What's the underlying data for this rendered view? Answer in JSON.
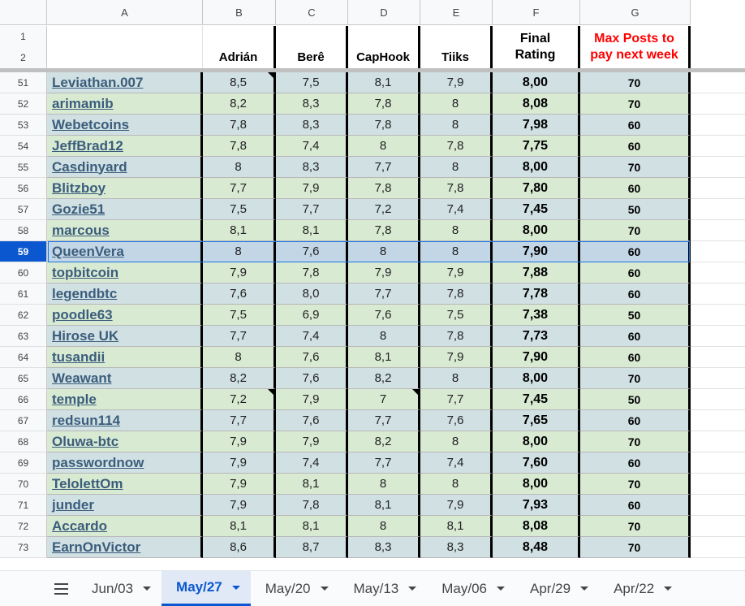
{
  "columns": [
    "A",
    "B",
    "C",
    "D",
    "E",
    "F",
    "G"
  ],
  "header": {
    "row_numbers": [
      "1",
      "2"
    ],
    "reviewers": [
      "Adrián",
      "Berê",
      "CapHook",
      "Tiiks"
    ],
    "final_rating": [
      "Final",
      "Rating"
    ],
    "max_posts": [
      "Max Posts to",
      "pay next week"
    ]
  },
  "rows": [
    {
      "n": "51",
      "user": "Leviathan.007",
      "b": "8,5",
      "c": "7,5",
      "d": "8,1",
      "e": "7,9",
      "final": "8,00",
      "max": "70"
    },
    {
      "n": "52",
      "user": "arimamib",
      "b": "8,2",
      "c": "8,3",
      "d": "7,8",
      "e": "8",
      "final": "8,08",
      "max": "70"
    },
    {
      "n": "53",
      "user": "Webetcoins",
      "b": "7,8",
      "c": "8,3",
      "d": "7,8",
      "e": "8",
      "final": "7,98",
      "max": "60"
    },
    {
      "n": "54",
      "user": "JeffBrad12",
      "b": "7,8",
      "c": "7,4",
      "d": "8",
      "e": "7,8",
      "final": "7,75",
      "max": "60"
    },
    {
      "n": "55",
      "user": "Casdinyard",
      "b": "8",
      "c": "8,3",
      "d": "7,7",
      "e": "8",
      "final": "8,00",
      "max": "70"
    },
    {
      "n": "56",
      "user": "Blitzboy",
      "b": "7,7",
      "c": "7,9",
      "d": "7,8",
      "e": "7,8",
      "final": "7,80",
      "max": "60"
    },
    {
      "n": "57",
      "user": "Gozie51",
      "b": "7,5",
      "c": "7,7",
      "d": "7,2",
      "e": "7,4",
      "final": "7,45",
      "max": "50"
    },
    {
      "n": "58",
      "user": "marcous",
      "b": "8,1",
      "c": "8,1",
      "d": "7,8",
      "e": "8",
      "final": "8,00",
      "max": "70"
    },
    {
      "n": "59",
      "user": "QueenVera",
      "b": "8",
      "c": "7,6",
      "d": "8",
      "e": "8",
      "final": "7,90",
      "max": "60"
    },
    {
      "n": "60",
      "user": "topbitcoin",
      "b": "7,9",
      "c": "7,8",
      "d": "7,9",
      "e": "7,9",
      "final": "7,88",
      "max": "60"
    },
    {
      "n": "61",
      "user": "legendbtc",
      "b": "7,6",
      "c": "8,0",
      "d": "7,7",
      "e": "7,8",
      "final": "7,78",
      "max": "60"
    },
    {
      "n": "62",
      "user": "poodle63",
      "b": "7,5",
      "c": "6,9",
      "d": "7,6",
      "e": "7,5",
      "final": "7,38",
      "max": "50"
    },
    {
      "n": "63",
      "user": "Hirose UK",
      "b": "7,7",
      "c": "7,4",
      "d": "8",
      "e": "7,8",
      "final": "7,73",
      "max": "60"
    },
    {
      "n": "64",
      "user": "tusandii",
      "b": "8",
      "c": "7,6",
      "d": "8,1",
      "e": "7,9",
      "final": "7,90",
      "max": "60"
    },
    {
      "n": "65",
      "user": "Weawant",
      "b": "8,2",
      "c": "7,6",
      "d": "8,2",
      "e": "8",
      "final": "8,00",
      "max": "70"
    },
    {
      "n": "66",
      "user": "temple",
      "b": "7,2",
      "c": "7,9",
      "d": "7",
      "e": "7,7",
      "final": "7,45",
      "max": "50"
    },
    {
      "n": "67",
      "user": "redsun114",
      "b": "7,7",
      "c": "7,6",
      "d": "7,7",
      "e": "7,6",
      "final": "7,65",
      "max": "60"
    },
    {
      "n": "68",
      "user": "Oluwa-btc",
      "b": "7,9",
      "c": "7,9",
      "d": "8,2",
      "e": "8",
      "final": "8,00",
      "max": "70"
    },
    {
      "n": "69",
      "user": "passwordnow",
      "b": "7,9",
      "c": "7,4",
      "d": "7,7",
      "e": "7,4",
      "final": "7,60",
      "max": "60"
    },
    {
      "n": "70",
      "user": "TelolettOm",
      "b": "7,9",
      "c": "8,1",
      "d": "8",
      "e": "8",
      "final": "8,00",
      "max": "70"
    },
    {
      "n": "71",
      "user": "junder",
      "b": "7,9",
      "c": "7,8",
      "d": "8,1",
      "e": "7,9",
      "final": "7,93",
      "max": "60"
    },
    {
      "n": "72",
      "user": "Accardo",
      "b": "8,1",
      "c": "8,1",
      "d": "8",
      "e": "8,1",
      "final": "8,08",
      "max": "70"
    },
    {
      "n": "73",
      "user": "EarnOnVictor",
      "b": "8,6",
      "c": "8,7",
      "d": "8,3",
      "e": "8,3",
      "final": "8,48",
      "max": "70"
    }
  ],
  "selected_row": "59",
  "tabs": [
    {
      "label": "Jun/03",
      "active": false
    },
    {
      "label": "May/27",
      "active": true
    },
    {
      "label": "May/20",
      "active": false
    },
    {
      "label": "May/13",
      "active": false
    },
    {
      "label": "May/06",
      "active": false
    },
    {
      "label": "Apr/29",
      "active": false
    },
    {
      "label": "Apr/22",
      "active": false
    }
  ],
  "icons": {
    "sheet_menu": "hamburger-menu-icon",
    "tab_dropdown": "caret-down-icon"
  },
  "colors": {
    "selection": "#1a73e8",
    "row_teal": "#d0e0e3",
    "row_green": "#d9ead3",
    "max_posts_header": "#ff0000"
  }
}
